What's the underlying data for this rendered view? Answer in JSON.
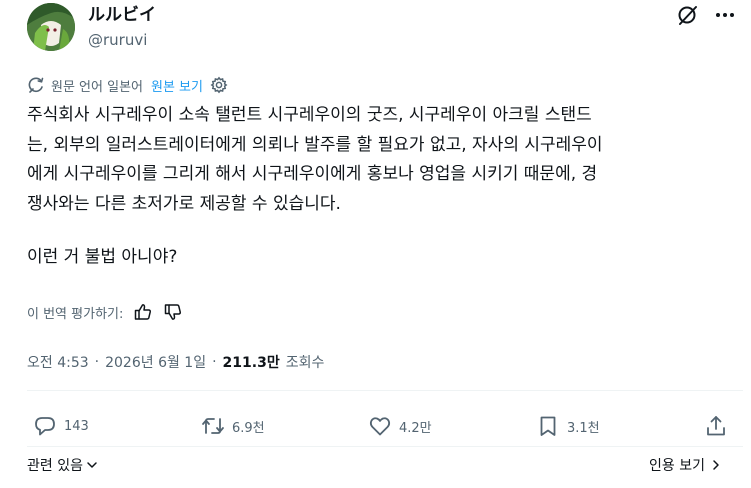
{
  "author": {
    "display_name": "ルルビイ",
    "handle": "@ruruvi"
  },
  "translation": {
    "notice": "원문 언어 일본어",
    "show_original": "원본 보기"
  },
  "tweet": {
    "lines": [
      "주식회사 시구레우이 소속 탤런트 시구레우이의 굿즈, 시구레우이 아크릴 스탠드",
      "는, 외부의 일러스트레이터에게 의뢰나 발주를 할 필요가 없고, 자사의 시구레우이",
      "에게 시구레우이를 그리게 해서 시구레우이에게 홍보나 영업을 시키기 때문에, 경",
      "쟁사와는 다른 초저가로 제공할 수 있습니다."
    ],
    "last_line": "이런 거 불법 아니야?"
  },
  "rate": {
    "label": "이 번역 평가하기:"
  },
  "meta": {
    "time": "오전 4:53",
    "separator": "·",
    "date": "2026년 6월 1일",
    "views_count": "211.3만",
    "views_label": "조회수"
  },
  "actions": {
    "reply_count": "143",
    "retweet_count": "6.9천",
    "like_count": "4.2만",
    "bookmark_count": "3.1천"
  },
  "footer": {
    "related": "관련 있음",
    "view_quotes": "인용 보기"
  },
  "colors": {
    "accent": "#1d9bf0",
    "text": "#0f1419",
    "muted": "#536471",
    "divider": "#eff3f4"
  }
}
